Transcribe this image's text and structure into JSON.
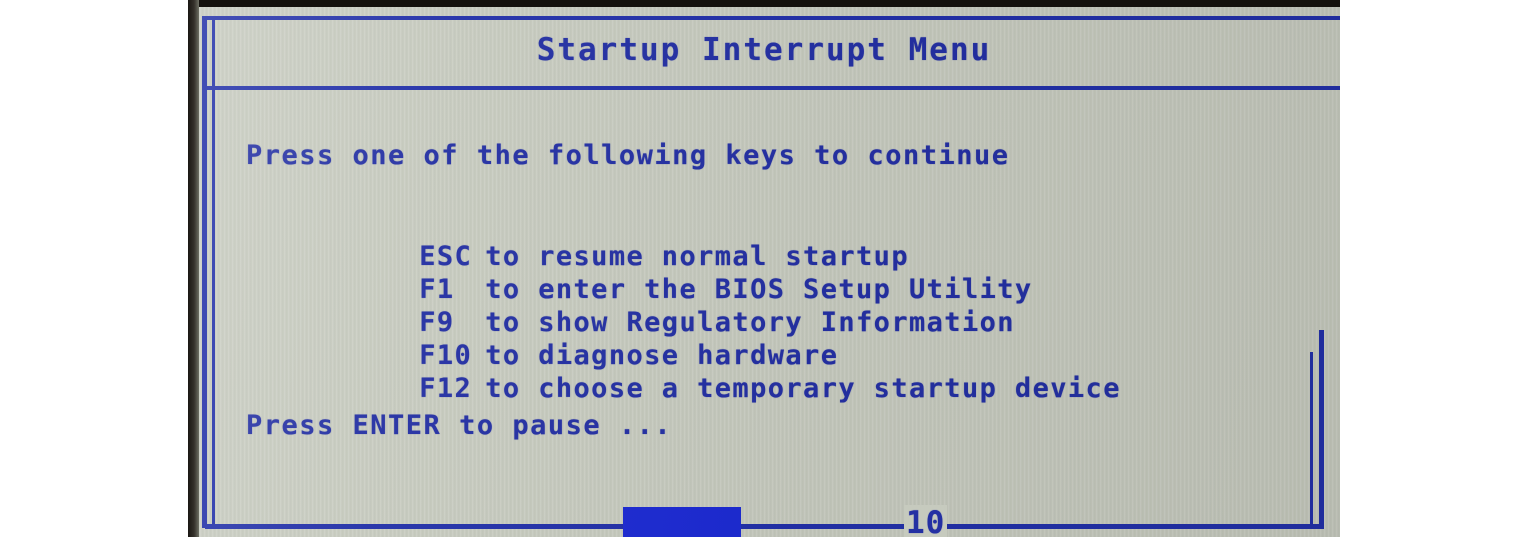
{
  "screen": {
    "title": "Startup Interrupt Menu",
    "prompt": "Press one of the following keys to continue",
    "pause_line": "Press ENTER to pause ...",
    "countdown": "10",
    "background_color": "#c6cabe",
    "text_color": "#2430a3",
    "border_color": "#2230a8",
    "progress_color": "#1c2ad2"
  },
  "keys": [
    {
      "key": "ESC",
      "action": "to resume normal startup"
    },
    {
      "key": "F1",
      "action": "to enter the BIOS Setup Utility"
    },
    {
      "key": "F9",
      "action": "to show Regulatory Information"
    },
    {
      "key": "F10",
      "action": "to diagnose hardware"
    },
    {
      "key": "F12",
      "action": "to choose a temporary startup device"
    }
  ]
}
